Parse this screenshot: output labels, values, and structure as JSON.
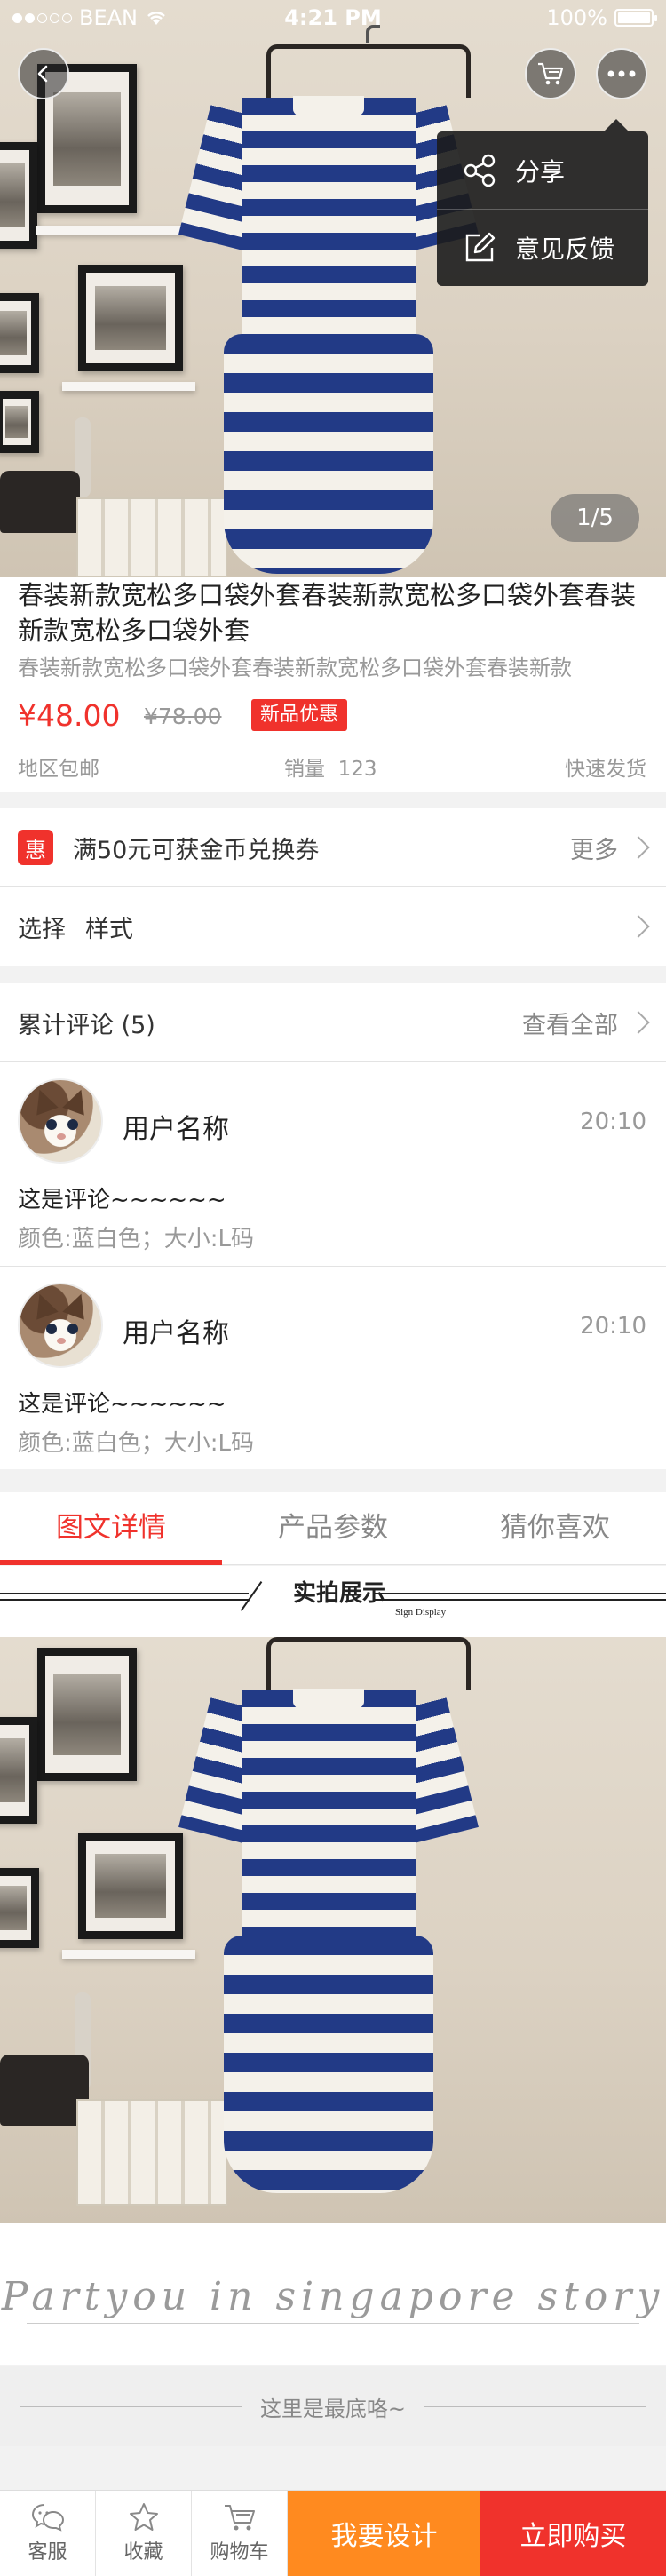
{
  "status_bar": {
    "carrier": "BEAN",
    "time": "4:21 PM",
    "battery": "100%"
  },
  "hero": {
    "page_indicator": "1/5",
    "popup_menu": [
      {
        "label": "分享",
        "icon": "share-icon"
      },
      {
        "label": "意见反馈",
        "icon": "edit-icon"
      }
    ]
  },
  "product": {
    "title": "春装新款宽松多口袋外套春装新款宽松多口袋外套春装新款宽松多口袋外套",
    "subtitle": "春装新款宽松多口袋外套春装新款宽松多口袋外套春装新款",
    "price": "¥48.00",
    "old_price": "¥78.00",
    "badge": "新品优惠",
    "shipping_region": "地区包邮",
    "sales_label": "销量",
    "sales_count": "123",
    "delivery": "快速发货"
  },
  "promo": {
    "icon_char": "惠",
    "text": "满50元可获金币兑换券",
    "more": "更多"
  },
  "select_row": {
    "label": "选择",
    "value": "样式"
  },
  "reviews": {
    "header": "累计评论 (5)",
    "view_all": "查看全部",
    "items": [
      {
        "user": "用户名称",
        "time": "20:10",
        "text": "这是评论~~~~~~",
        "spec": "颜色:蓝白色；大小:L码"
      },
      {
        "user": "用户名称",
        "time": "20:10",
        "text": "这是评论~~~~~~",
        "spec": "颜色:蓝白色；大小:L码"
      }
    ]
  },
  "tabs": [
    {
      "label": "图文详情",
      "active": true
    },
    {
      "label": "产品参数",
      "active": false
    },
    {
      "label": "猜你喜欢",
      "active": false
    }
  ],
  "detail": {
    "banner_title": "实拍展示",
    "banner_subtitle": "Sign Display",
    "script_text": "Partyou in singapore story"
  },
  "end_note": "这里是最底咯~",
  "bottom_bar": {
    "service": "客服",
    "favorite": "收藏",
    "cart": "购物车",
    "design": "我要设计",
    "buy": "立即购买"
  },
  "colors": {
    "accent": "#f0322c",
    "design_button": "#ff8a1f",
    "stripe_blue": "#223a86"
  }
}
